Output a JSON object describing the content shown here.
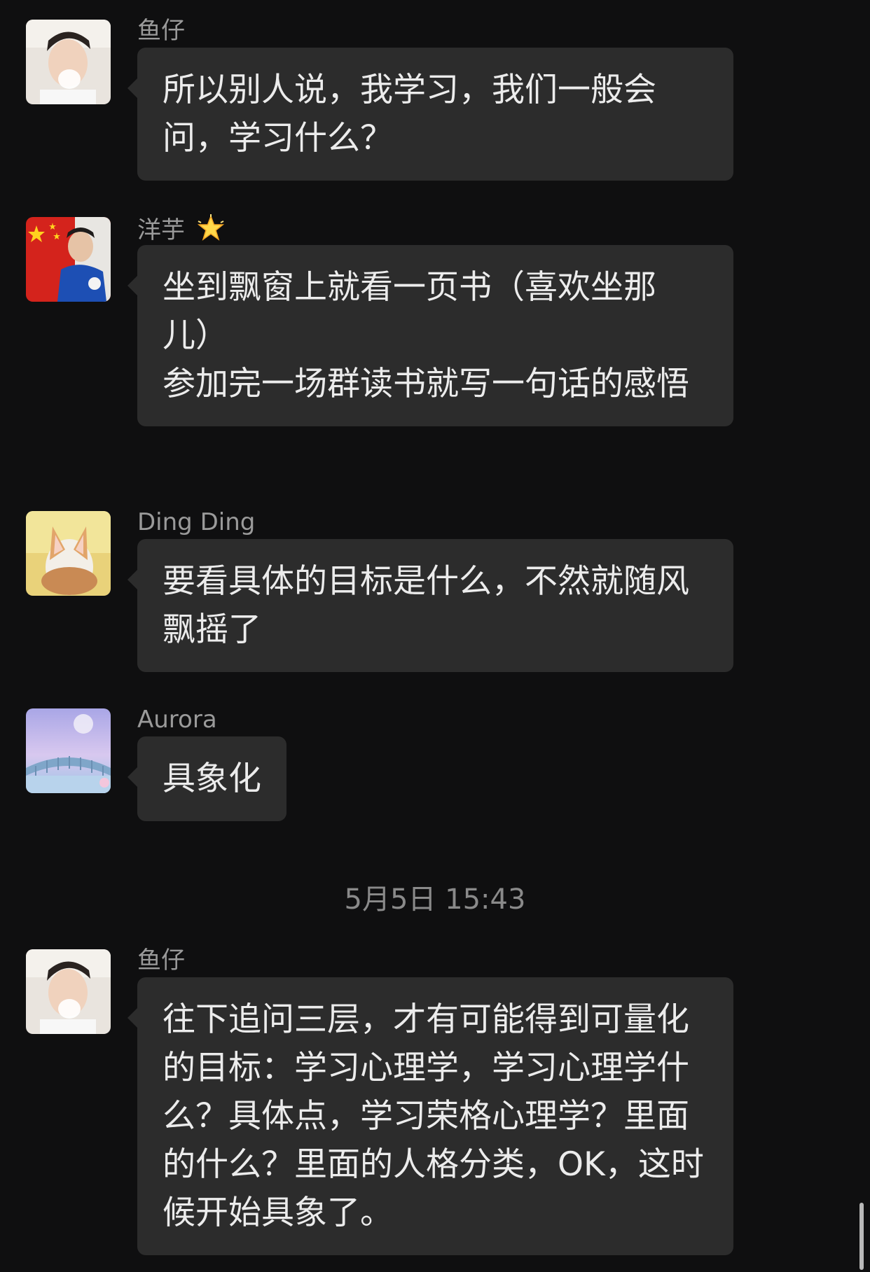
{
  "messages": [
    {
      "sender": "鱼仔",
      "text": "所以别人说，我学习，我们一般会问，学习什么？"
    },
    {
      "sender": "洋芋",
      "sender_emoji": "glowing-star-icon",
      "text": "坐到飘窗上就看一页书（喜欢坐那儿）\n参加完一场群读书就写一句话的感悟"
    },
    {
      "sender": "Ding Ding",
      "text": "要看具体的目标是什么，不然就随风飘摇了"
    },
    {
      "sender": "Aurora",
      "text": "具象化"
    },
    {
      "sender": "鱼仔",
      "text": "往下追问三层，才有可能得到可量化的目标：学习心理学，学习心理学什么？具体点，学习荣格心理学？里面的什么？里面的人格分类，OK，这时候开始具象了。"
    }
  ],
  "timestamp": "5月5日 15:43",
  "colors": {
    "background": "#0f0f10",
    "bubble": "#2c2c2c",
    "sender_name": "#9a9a9a",
    "message_text": "#ececec",
    "timestamp": "#8a8a8a"
  }
}
